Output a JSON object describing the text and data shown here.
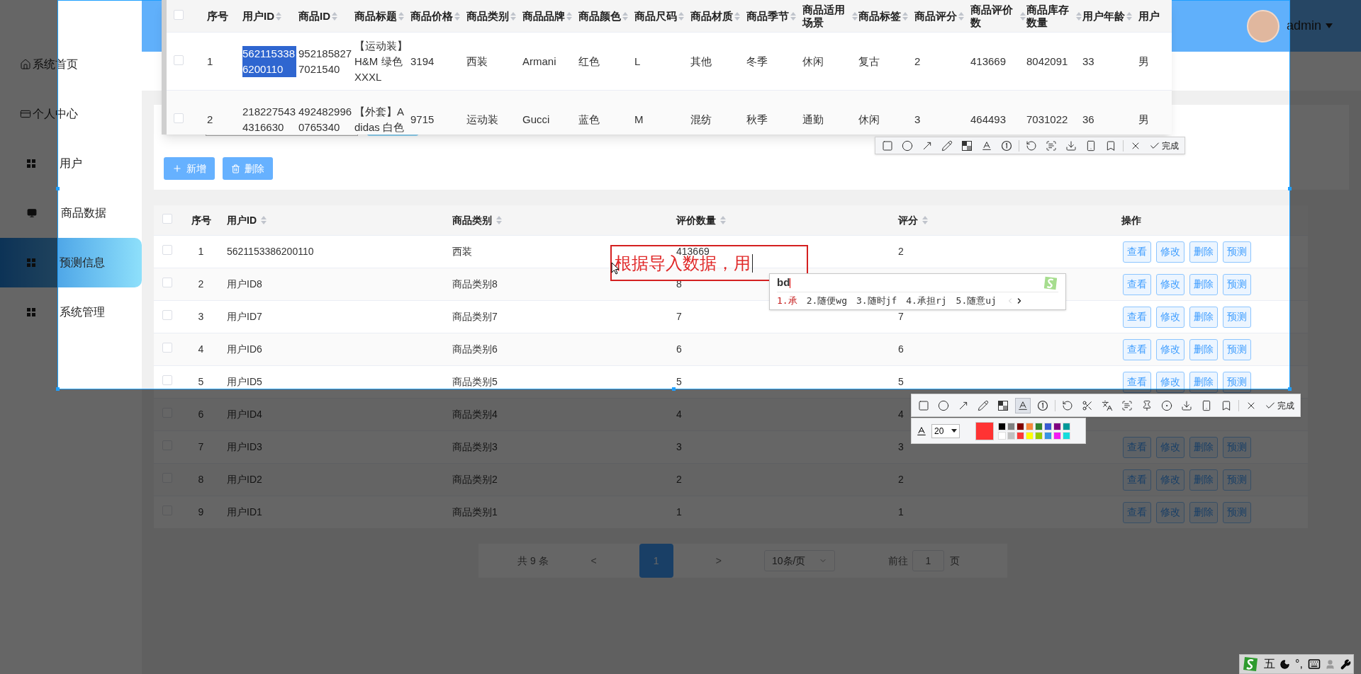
{
  "sidebar": {
    "items": [
      {
        "label": "系统首页",
        "kind": "home",
        "selected": false
      },
      {
        "label": "个人中心",
        "kind": "card",
        "selected": false
      },
      {
        "label": "用户",
        "kind": "grid",
        "selected": false
      },
      {
        "label": "商品数据",
        "kind": "monitor",
        "selected": false
      },
      {
        "label": "预测信息",
        "kind": "grid",
        "selected": true
      },
      {
        "label": "系统管理",
        "kind": "grid",
        "selected": false
      }
    ]
  },
  "header": {
    "user": "admin"
  },
  "search_panel": {
    "buttons": [
      {
        "label": "新增",
        "kind": "add"
      },
      {
        "label": "删除",
        "kind": "delete"
      }
    ]
  },
  "table": {
    "all_checked": false,
    "columns": [
      {
        "label": "序号",
        "sortable": false
      },
      {
        "label": "用户ID",
        "sortable": true
      },
      {
        "label": "商品类别",
        "sortable": true
      },
      {
        "label": "评价数量",
        "sortable": true
      },
      {
        "label": "评分",
        "sortable": true
      },
      {
        "label": "操作",
        "sortable": false
      }
    ],
    "rows": [
      {
        "checked": false,
        "cells": [
          "1",
          "5621153386200110",
          "西装",
          "413669",
          "2"
        ],
        "actions": [
          "查看",
          "修改",
          "删除",
          "预测"
        ]
      },
      {
        "checked": false,
        "cells": [
          "2",
          "用户ID8",
          "商品类别8",
          "8"
        ],
        "actions": [
          "查看",
          "修改",
          "删除",
          "预测"
        ]
      },
      {
        "checked": false,
        "cells": [
          "3",
          "用户ID7",
          "商品类别7",
          "7",
          "7"
        ],
        "actions": [
          "查看",
          "修改",
          "删除",
          "预测"
        ]
      },
      {
        "checked": false,
        "cells": [
          "4",
          "用户ID6",
          "商品类别6",
          "6",
          "6"
        ],
        "actions": [
          "查看",
          "修改",
          "删除",
          "预测"
        ]
      },
      {
        "checked": false,
        "cells": [
          "5",
          "用户ID5",
          "商品类别5",
          "5",
          "5"
        ],
        "actions": [
          "查看",
          "修改",
          "删除",
          "预测"
        ]
      },
      {
        "checked": false,
        "cells": [
          "6",
          "用户ID4",
          "商品类别4",
          "4",
          "4"
        ]
      },
      {
        "checked": false,
        "cells": [
          "7",
          "用户ID3",
          "商品类别3",
          "3",
          "3"
        ],
        "actions": [
          "查看",
          "修改",
          "删除",
          "预测"
        ]
      },
      {
        "checked": false,
        "cells": [
          "8",
          "用户ID2",
          "商品类别2",
          "2",
          "2"
        ],
        "actions": [
          "查看",
          "修改",
          "删除",
          "预测"
        ]
      },
      {
        "checked": false,
        "cells": [
          "9",
          "用户ID1",
          "商品类别1",
          "1",
          "1"
        ],
        "actions": [
          "查看",
          "修改",
          "删除",
          "预测"
        ]
      }
    ]
  },
  "pagination": {
    "total": "共 9 条",
    "prev": "<",
    "pages": [
      {
        "label": "1",
        "selected": true
      }
    ],
    "next": ">",
    "page_size": "10条/页",
    "goto_label": "前往",
    "goto_value": "1",
    "goto_suffix": "页"
  },
  "pinned_table": {
    "all_checked": false,
    "columns": [
      {
        "label": "序号",
        "sortable": false
      },
      {
        "label": "用户ID",
        "sortable": true
      },
      {
        "label": "商品ID",
        "sortable": true
      },
      {
        "label": "商品标题",
        "sortable": true
      },
      {
        "label": "商品价格",
        "sortable": true
      },
      {
        "label": "商品类别",
        "sortable": true
      },
      {
        "label": "商品品牌",
        "sortable": true
      },
      {
        "label": "商品颜色",
        "sortable": true
      },
      {
        "label": "商品尺码",
        "sortable": true
      },
      {
        "label": "商品材质",
        "sortable": true
      },
      {
        "label": "商品季节",
        "sortable": true
      },
      {
        "label": "商品适用场景",
        "sortable": true
      },
      {
        "label": "商品标签",
        "sortable": true
      },
      {
        "label": "商品评分",
        "sortable": true
      },
      {
        "label": "商品评价数",
        "sortable": true
      },
      {
        "label": "商品库存数量",
        "sortable": true
      },
      {
        "label": "用户年龄",
        "sortable": true
      },
      {
        "label": "用户",
        "sortable": false
      }
    ],
    "rows": [
      {
        "checked": false,
        "cells": [
          "1",
          "5621153386200110",
          "9521858277021540",
          "【运动装】H&M 绿色XXXL",
          "3194",
          "西装",
          "Armani",
          "红色",
          "L",
          "其他",
          "冬季",
          "休闲",
          "复古",
          "2",
          "413669",
          "8042091",
          "33",
          "男"
        ],
        "text_selected": true
      },
      {
        "checked": false,
        "cells": [
          "2",
          "2182275434316630",
          "4924829960765340",
          "【外套】Adidas 白色",
          "9715",
          "运动装",
          "Gucci",
          "蓝色",
          "M",
          "混纺",
          "秋季",
          "通勤",
          "休闲",
          "3",
          "464493",
          "7031022",
          "36",
          "男"
        ],
        "text_selected": false
      }
    ]
  },
  "toolbar_top": {
    "tools": [
      {
        "kind": "rect",
        "selected": false
      },
      {
        "kind": "circle",
        "selected": false
      },
      {
        "kind": "arrow",
        "selected": false
      },
      {
        "kind": "pencil",
        "selected": false
      },
      {
        "kind": "mosaic",
        "selected": false
      },
      {
        "kind": "text",
        "selected": false
      },
      {
        "kind": "number",
        "selected": false
      },
      {
        "kind": "separator"
      },
      {
        "kind": "undo",
        "selected": false
      },
      {
        "kind": "ocr",
        "selected": false
      },
      {
        "kind": "download",
        "selected": false
      },
      {
        "kind": "phone",
        "selected": false
      },
      {
        "kind": "bookmark",
        "selected": false
      },
      {
        "kind": "separator"
      },
      {
        "kind": "close",
        "selected": false
      }
    ],
    "done": "完成"
  },
  "toolbar_bottom": {
    "tools": [
      {
        "kind": "rect",
        "selected": false
      },
      {
        "kind": "circle",
        "selected": false
      },
      {
        "kind": "arrow",
        "selected": false
      },
      {
        "kind": "pencil",
        "selected": false
      },
      {
        "kind": "mosaic",
        "selected": false
      },
      {
        "kind": "text",
        "selected": true
      },
      {
        "kind": "number",
        "selected": false
      },
      {
        "kind": "separator"
      },
      {
        "kind": "undo",
        "selected": false
      },
      {
        "kind": "cut",
        "selected": false
      },
      {
        "kind": "translate",
        "selected": false
      },
      {
        "kind": "ocr",
        "selected": false
      },
      {
        "kind": "pin",
        "selected": false
      },
      {
        "kind": "record",
        "selected": false
      },
      {
        "kind": "download",
        "selected": false
      },
      {
        "kind": "phone",
        "selected": false
      },
      {
        "kind": "bookmark",
        "selected": false
      },
      {
        "kind": "separator"
      },
      {
        "kind": "close",
        "selected": false
      }
    ],
    "done": "完成"
  },
  "text_options": {
    "size": "20",
    "color": "#ff3333",
    "palette": [
      {
        "color": "#000000"
      },
      {
        "color": "#808080"
      },
      {
        "color": "#800000"
      },
      {
        "color": "#f7883a"
      },
      {
        "color": "#308430"
      },
      {
        "color": "#385ad3"
      },
      {
        "color": "#800080"
      },
      {
        "color": "#009999"
      },
      {
        "color": "#ffffff"
      },
      {
        "color": "#c0c0c0"
      },
      {
        "color": "#fb3838"
      },
      {
        "color": "#ffff00"
      },
      {
        "color": "#99cc00"
      },
      {
        "color": "#3894e4"
      },
      {
        "color": "#f31bf3"
      },
      {
        "color": "#16dcdc"
      }
    ]
  },
  "annotation": {
    "text": "根据导入数据，用"
  },
  "ime": {
    "input": "bd",
    "candidates": [
      {
        "label": "1.承",
        "selected": true
      },
      {
        "label": "2.随便wg",
        "selected": false
      },
      {
        "label": "3.随时jf",
        "selected": false
      },
      {
        "label": "4.承担rj",
        "selected": false
      },
      {
        "label": "5.随意uj",
        "selected": false
      }
    ]
  },
  "ime_status": {
    "items": [
      {
        "kind": "logo"
      },
      {
        "kind": "text",
        "label": "五"
      },
      {
        "kind": "moon"
      },
      {
        "kind": "text",
        "label": "°,"
      },
      {
        "kind": "keyboard"
      },
      {
        "kind": "user"
      },
      {
        "kind": "wrench"
      }
    ]
  }
}
